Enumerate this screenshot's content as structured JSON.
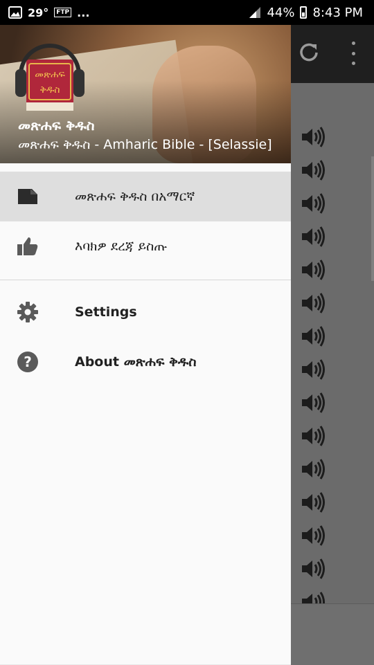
{
  "status_bar": {
    "temperature": "29°",
    "ftp_label": "FTP",
    "overflow": "...",
    "battery": "44%",
    "time": "8:43 PM"
  },
  "drawer": {
    "header": {
      "logo_text_top": "መጽሐፍ",
      "logo_text_bottom": "ቅዱስ",
      "title": "መጽሐፍ ቅዱስ",
      "subtitle": "መጽሐፍ ቅዱስ - Amharic Bible - [Selassie]"
    },
    "items": [
      {
        "label": "መጽሐፍ ቅዱስ  በአማርኛ",
        "icon": "book-icon",
        "active": true
      },
      {
        "label": "እባክዎ ደረጃ ይስጡ",
        "icon": "thumbs-up-icon",
        "active": false
      },
      {
        "label": "Settings",
        "icon": "gear-icon",
        "active": false
      },
      {
        "label": "About መጽሐፍ ቅዱስ",
        "icon": "help-icon",
        "active": false
      }
    ]
  },
  "background_app": {
    "toolbar_icons": [
      "refresh-icon",
      "more-vert-icon"
    ],
    "row_icon": "speaker-icon"
  },
  "colors": {
    "status_bar": "#000000",
    "drawer_bg": "#fafafa",
    "active_item_bg": "#dedede",
    "scrim": "#6b6b6b",
    "toolbar": "#1f1f1f"
  }
}
